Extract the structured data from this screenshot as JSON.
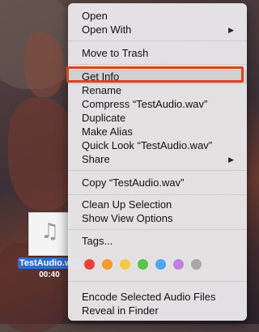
{
  "desktop": {
    "file": {
      "name": "TestAudio.wav",
      "label_visible": "TestAudio.w",
      "duration": "00:40"
    }
  },
  "menu": {
    "items": {
      "open": "Open",
      "open_with": "Open With",
      "move_to_trash": "Move to Trash",
      "get_info": "Get Info",
      "rename": "Rename",
      "compress": "Compress “TestAudio.wav”",
      "duplicate": "Duplicate",
      "make_alias": "Make Alias",
      "quick_look": "Quick Look “TestAudio.wav”",
      "share": "Share",
      "copy": "Copy “TestAudio.wav”",
      "clean_up": "Clean Up Selection",
      "view_options": "Show View Options",
      "tags": "Tags...",
      "encode": "Encode Selected Audio Files",
      "reveal": "Reveal in Finder"
    },
    "submenu_arrow": "▶",
    "tag_colors": [
      "#e8433a",
      "#f29a2e",
      "#f3c844",
      "#5bc148",
      "#4ba7ee",
      "#c37fe0",
      "#a7a7a7"
    ]
  }
}
